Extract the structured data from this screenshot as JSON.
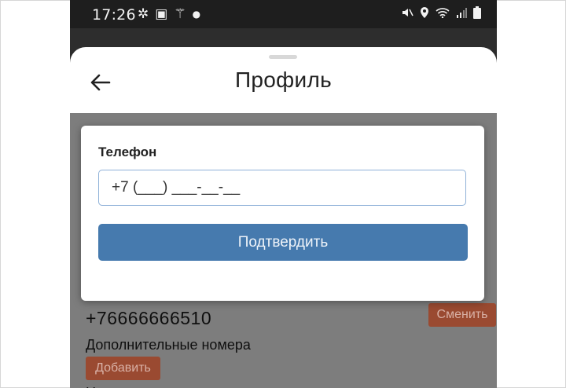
{
  "status_bar": {
    "time": "17:26",
    "left_icons": [
      "pinwheel-icon",
      "image-icon",
      "magic-wand-icon",
      "dot-icon"
    ],
    "right_icons": [
      "mute-icon",
      "location-icon",
      "wifi-icon",
      "signal-icon",
      "battery-icon"
    ]
  },
  "header": {
    "title": "Профиль",
    "back_icon": "arrow-left-icon"
  },
  "dialog": {
    "field_label": "Телефон",
    "phone_placeholder": "+7 (___) ___-__-__",
    "confirm_label": "Подтвердить"
  },
  "profile": {
    "phone_number": "+76666666510",
    "change_label": "Сменить",
    "extra_numbers_label": "Дополнительные номера",
    "add_label": "Добавить",
    "cut_text": "Н"
  },
  "colors": {
    "primary_button": "#467aae",
    "accent_button": "#9a4a31",
    "overlay": "#7d7d7d"
  }
}
